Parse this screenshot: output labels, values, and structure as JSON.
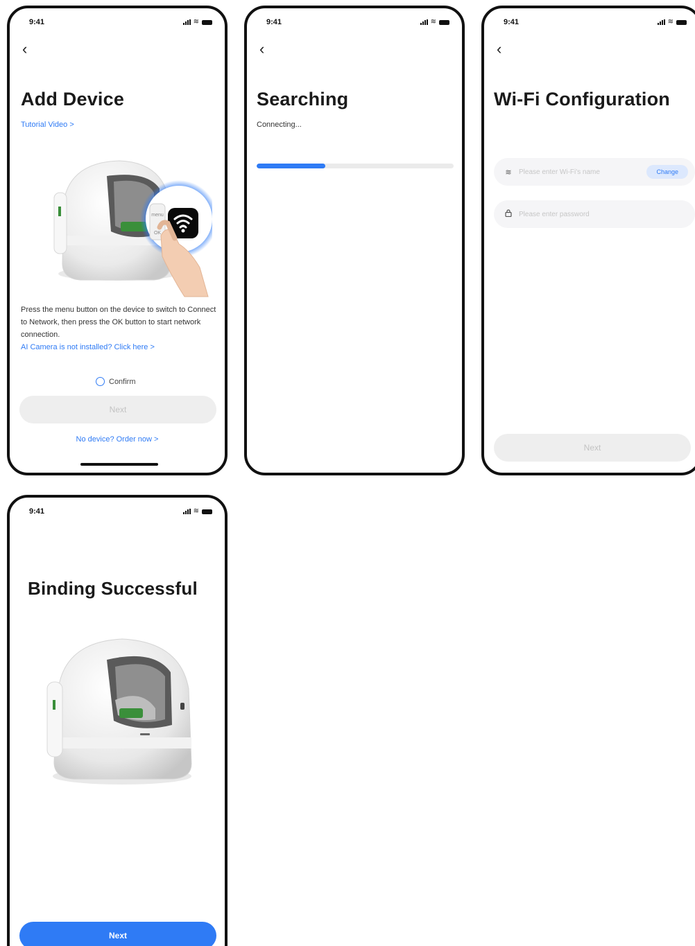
{
  "status_bar": {
    "time": "9:41"
  },
  "screens": {
    "add_device": {
      "title": "Add Device",
      "tutorial_link": "Tutorial Video >",
      "description": "Press the menu button on the device to switch to Connect to Network, then press the OK button to start network connection.",
      "ai_camera_link": "AI Camera is not installed? Click here >",
      "confirm_label": "Confirm",
      "next_label": "Next",
      "order_link": "No device? Order now >",
      "device_buttons": {
        "menu": "menu",
        "ok": "OK"
      }
    },
    "searching": {
      "title": "Searching",
      "subtitle": "Connecting...",
      "progress": 0.35
    },
    "wifi_config": {
      "title": "Wi-Fi Configuration",
      "ssid_placeholder": "Please enter Wi-Fi's name",
      "change_label": "Change",
      "password_placeholder": "Please enter password",
      "next_label": "Next"
    },
    "binding_success": {
      "title": "Binding Successful",
      "next_label": "Next"
    }
  },
  "colors": {
    "accent": "#2f7bf5",
    "disabled_button": "#eeeeee",
    "disabled_text": "#c3c3c3",
    "device_accent": "#3a8f3a"
  },
  "icons": [
    "back-chevron-icon",
    "signal-icon",
    "wifi-icon",
    "battery-icon",
    "lock-icon",
    "radio-icon"
  ]
}
